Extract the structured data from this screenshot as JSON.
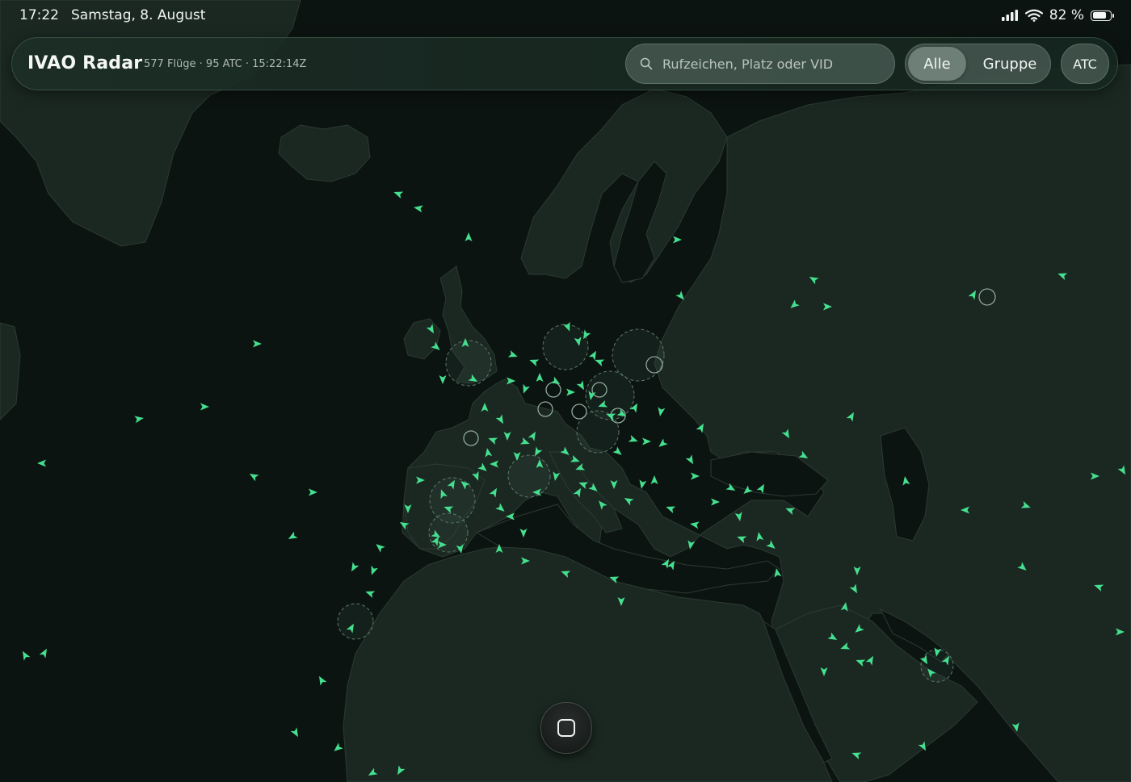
{
  "status_bar": {
    "time": "17:22",
    "date": "Samstag, 8. August",
    "battery": "82 %",
    "battery_level": 0.82
  },
  "header": {
    "title": "IVAO Radar",
    "stats": "577 Flüge · 95 ATC · 15:22:14Z"
  },
  "search": {
    "placeholder": "Rufzeichen, Platz oder VID"
  },
  "filter": {
    "all_label": "Alle",
    "group_label": "Gruppe",
    "selected": "Alle"
  },
  "atc_button": {
    "label": "ATC"
  },
  "colors": {
    "aircraft": "#45e08f",
    "land": "#1b2822",
    "sea": "#0c1411",
    "border": "#2c3a33",
    "atc_ring": "#5d7a6a"
  },
  "icons": {
    "search": "search-icon",
    "home": "home-square-icon",
    "signal": "cellular-signal-icon",
    "wifi": "wifi-icon",
    "battery": "battery-icon"
  }
}
